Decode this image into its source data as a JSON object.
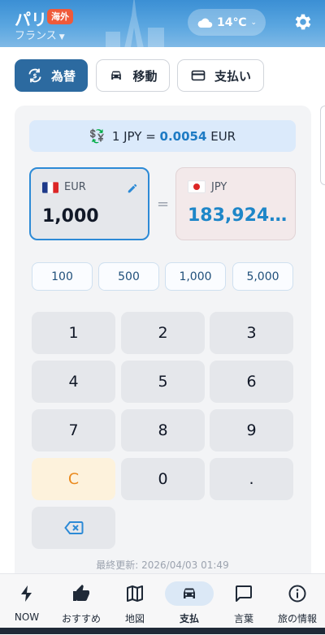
{
  "header": {
    "city": "パリ",
    "badge": "海外",
    "country": "フランス",
    "weather_temp": "14℃",
    "icons": [
      "cloud-icon",
      "gear-icon",
      "chevron-down-icon"
    ]
  },
  "tabs": [
    {
      "label": "為替",
      "icon": "currency-exchange-icon",
      "active": true
    },
    {
      "label": "移動",
      "icon": "car-icon",
      "active": false
    },
    {
      "label": "支払い",
      "icon": "credit-card-icon",
      "active": false
    }
  ],
  "converter": {
    "rate_prefix": "1 JPY =",
    "rate_value": "0.0054",
    "rate_suffix": "EUR",
    "from_code": "EUR",
    "from_amount": "1,000",
    "equals": "=",
    "to_code": "JPY",
    "to_amount": "183,924.…",
    "quick_amounts": [
      "100",
      "500",
      "1,000",
      "5,000"
    ],
    "keys": [
      "1",
      "2",
      "3",
      "4",
      "5",
      "6",
      "7",
      "8",
      "9",
      "C",
      "0",
      "."
    ],
    "updated": "最終更新: 2026/04/03 01:49"
  },
  "nav": [
    {
      "label": "NOW",
      "icon": "bolt-icon",
      "active": false
    },
    {
      "label": "おすすめ",
      "icon": "thumbs-up-icon",
      "active": false
    },
    {
      "label": "地図",
      "icon": "map-icon",
      "active": false
    },
    {
      "label": "支払",
      "icon": "car-icon",
      "active": true
    },
    {
      "label": "言葉",
      "icon": "chat-icon",
      "active": false
    },
    {
      "label": "旅の情報",
      "icon": "info-icon",
      "active": false
    }
  ],
  "colors": {
    "accent": "#2c6aa0",
    "rate_highlight": "#1e7bc4",
    "clear_key": "#ea8a1e",
    "badge": "#ef5a3a"
  }
}
